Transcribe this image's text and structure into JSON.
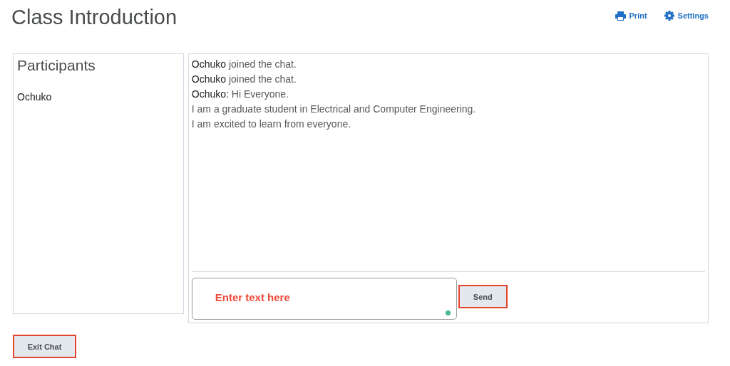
{
  "page": {
    "title": "Class Introduction"
  },
  "actions": [
    {
      "kind": "print",
      "label": "Print"
    },
    {
      "kind": "settings",
      "label": "Settings"
    }
  ],
  "participants": {
    "heading": "Participants",
    "items": [
      "Ochuko"
    ]
  },
  "messages": [
    "**Ochuko** joined the chat.",
    "**Ochuko** joined the chat.",
    "**Ochuko:** Hi Everyone.",
    "I am a graduate student in Electrical and Computer Engineering.",
    "I am excited to learn from everyone."
  ],
  "composer": {
    "placeholder": "Enter text here",
    "send": {
      "label": "Send",
      "highlighted": true
    }
  },
  "exit_button": {
    "label": "Exit Chat",
    "highlighted": true
  }
}
